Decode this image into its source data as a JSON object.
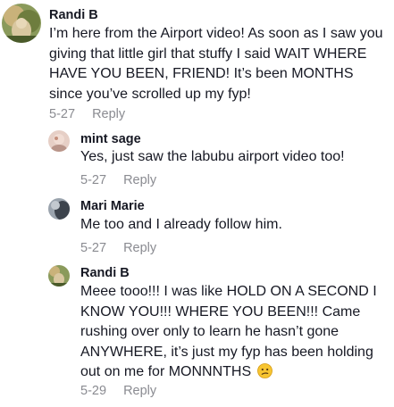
{
  "comments": [
    {
      "username": "Randi B",
      "text": "I’m here from the Airport video! As soon as I saw you giving that little girl that stuffy I said WAIT WHERE HAVE YOU BEEN, FRIEND! It’s been MONTHS since you’ve scrolled up my fyp!",
      "date": "5-27",
      "reply_label": "Reply"
    }
  ],
  "replies": [
    {
      "username": "mint sage",
      "text": "Yes, just saw the labubu airport video too!",
      "date": "5-27",
      "reply_label": "Reply"
    },
    {
      "username": "Mari Marie",
      "text": "Me too and I already follow him.",
      "date": "5-27",
      "reply_label": "Reply"
    },
    {
      "username": "Randi B",
      "text": "Meee tooo!!! I was like HOLD ON A SECOND I KNOW YOU!!! WHERE YOU BEEN!!! Came rushing over only to learn he hasn’t gone ANYWHERE, it’s just my fyp has been holding out on me for MONNNTHS",
      "emoji": "confused-face",
      "date": "5-29",
      "reply_label": "Reply"
    }
  ]
}
